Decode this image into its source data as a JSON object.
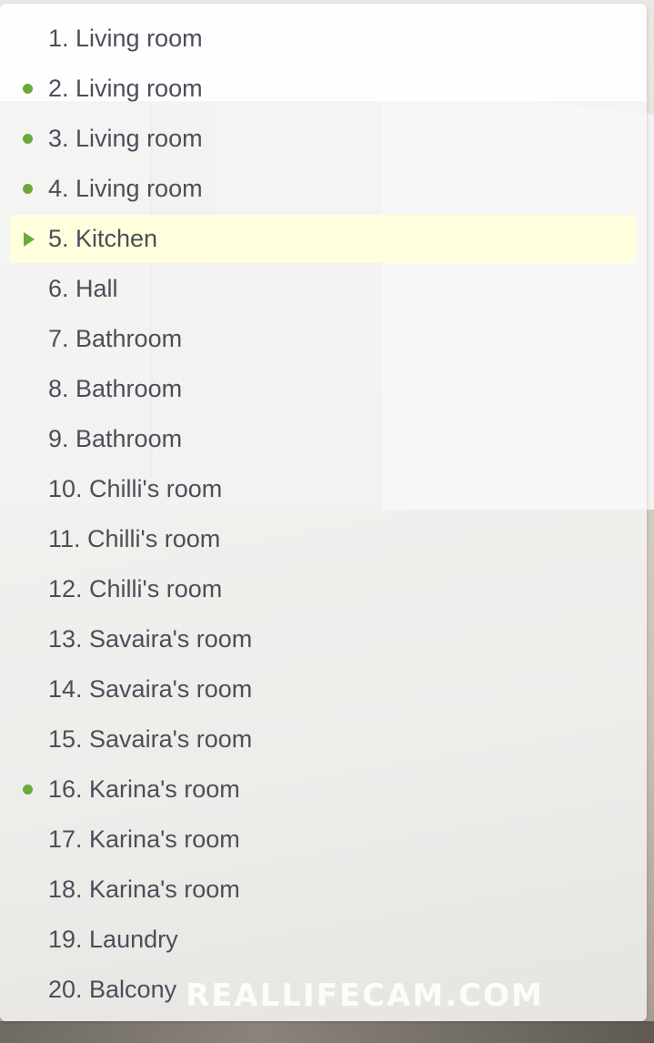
{
  "colors": {
    "active_indicator": "#6aaa3a",
    "active_row_bg": "#ffffdd",
    "text": "#4a4f59"
  },
  "camera_list": [
    {
      "label": "1. Living room",
      "status": "none"
    },
    {
      "label": "2. Living room",
      "status": "online"
    },
    {
      "label": "3. Living room",
      "status": "online"
    },
    {
      "label": "4. Living room",
      "status": "online"
    },
    {
      "label": "5. Kitchen",
      "status": "playing"
    },
    {
      "label": "6. Hall",
      "status": "none"
    },
    {
      "label": "7. Bathroom",
      "status": "none"
    },
    {
      "label": "8. Bathroom",
      "status": "none"
    },
    {
      "label": "9. Bathroom",
      "status": "none"
    },
    {
      "label": "10. Chilli's room",
      "status": "none"
    },
    {
      "label": "11. Chilli's room",
      "status": "none"
    },
    {
      "label": "12. Chilli's room",
      "status": "none"
    },
    {
      "label": "13. Savaira's room",
      "status": "none"
    },
    {
      "label": "14. Savaira's room",
      "status": "none"
    },
    {
      "label": "15. Savaira's room",
      "status": "none"
    },
    {
      "label": "16. Karina's room",
      "status": "online"
    },
    {
      "label": "17. Karina's room",
      "status": "none"
    },
    {
      "label": "18. Karina's room",
      "status": "none"
    },
    {
      "label": "19. Laundry",
      "status": "none"
    },
    {
      "label": "20. Balcony",
      "status": "none"
    }
  ],
  "watermark": "REALLIFECAM.COM"
}
